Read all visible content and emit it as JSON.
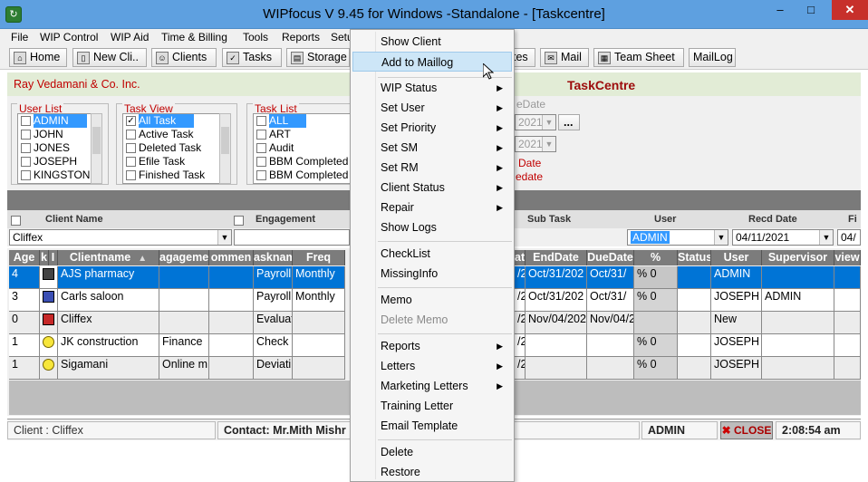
{
  "window": {
    "title": "WIPfocus V 9.45 for Windows -Standalone   - [Taskcentre]",
    "min": "–",
    "max": "□",
    "close": "✕"
  },
  "menu": [
    "File",
    "WIP Control",
    "WIP Aid",
    "Time & Billing",
    "Tools",
    "Reports",
    "Setu"
  ],
  "toolbar": [
    {
      "label": "Home"
    },
    {
      "label": "New Cli.."
    },
    {
      "label": "Clients"
    },
    {
      "label": "Tasks"
    },
    {
      "label": "Storage"
    },
    {
      "label": "tes"
    },
    {
      "label": "Mail"
    },
    {
      "label": "Team Sheet"
    },
    {
      "label": "MailLog"
    }
  ],
  "info": {
    "firm": "Ray Vedamani & Co. Inc.",
    "center": "TaskCentre"
  },
  "user_list": {
    "label": "User List",
    "items": [
      "ADMIN",
      "JOHN",
      "JONES",
      "JOSEPH",
      "KINGSTON"
    ]
  },
  "task_view": {
    "label": "Task View",
    "items": [
      "All Task",
      "Active Task",
      "Deleted Task",
      "Efile Task",
      "Finished Task"
    ]
  },
  "task_list": {
    "label": "Task List",
    "items": [
      "ALL",
      "ART",
      "Audit",
      "BBM Completed",
      "BBM Completed"
    ]
  },
  "due": {
    "label": "eDate",
    "d1": "2021",
    "d2": "2021",
    "btn": "...",
    "l1": "Date",
    "l2": "edate"
  },
  "hdr2": {
    "client_name": "Client Name",
    "engagement": "Engagement",
    "sub_task": "Sub Task",
    "user": "User",
    "recd_date": "Recd Date",
    "fi": "Fi"
  },
  "combos": {
    "client": "Cliffex",
    "user": "ADMIN",
    "recd": "04/11/2021",
    "fi": "04/"
  },
  "columns": [
    "Age",
    "k",
    "I",
    "Clientname",
    "agageme",
    "ommen",
    "asknam",
    "Freq",
    "at",
    "EndDate",
    "DueDate",
    "%",
    "Status",
    "User",
    "Supervisor",
    "view"
  ],
  "rows": [
    {
      "age": "4",
      "name": "AJS pharmacy",
      "eng": "",
      "task": "Payroll",
      "freq": "Monthly",
      "st": "/2",
      "end": "Oct/31/202",
      "due": "Oct/31/",
      "pct": "% 0",
      "user": "ADMIN",
      "sup": ""
    },
    {
      "age": "3",
      "name": "Carls saloon",
      "eng": "",
      "task": "Payroll",
      "freq": "Monthly",
      "st": "/2",
      "end": "Oct/31/202",
      "due": "Oct/31/",
      "pct": "% 0",
      "user": "JOSEPH",
      "sup": "ADMIN"
    },
    {
      "age": "0",
      "name": "Cliffex",
      "eng": "",
      "task": "Evaluat",
      "freq": "",
      "st": "/2",
      "end": "Nov/04/202",
      "due": "Nov/04/2",
      "pct": "",
      "user": "New",
      "sup": ""
    },
    {
      "age": "1",
      "name": "JK construction",
      "eng": "Finance",
      "task": "Check",
      "freq": "",
      "st": "/2",
      "end": "",
      "due": "",
      "pct": "% 0",
      "user": "JOSEPH",
      "sup": ""
    },
    {
      "age": "1",
      "name": "Sigamani",
      "eng": "Online m",
      "task": "Deviati",
      "freq": "",
      "st": "/2",
      "end": "",
      "due": "",
      "pct": "% 0",
      "user": "JOSEPH",
      "sup": ""
    }
  ],
  "status": {
    "client": "Client :  Cliffex",
    "contact": "Contact: Mr.Mith Mishr",
    "user": "ADMIN",
    "close": "CLOSE",
    "time": "2:08:54 am"
  },
  "context_menu": [
    "Show Client",
    "Add to Maillog",
    "WIP Status",
    "Set User",
    "Set Priority",
    "Set SM",
    "Set RM",
    "Client Status",
    "Repair",
    "Show Logs",
    "CheckList",
    "MissingInfo",
    "Memo",
    "Delete Memo",
    "Reports",
    "Letters",
    "Marketing Letters",
    "Training Letter",
    "Email Template",
    "Delete",
    "Restore"
  ]
}
